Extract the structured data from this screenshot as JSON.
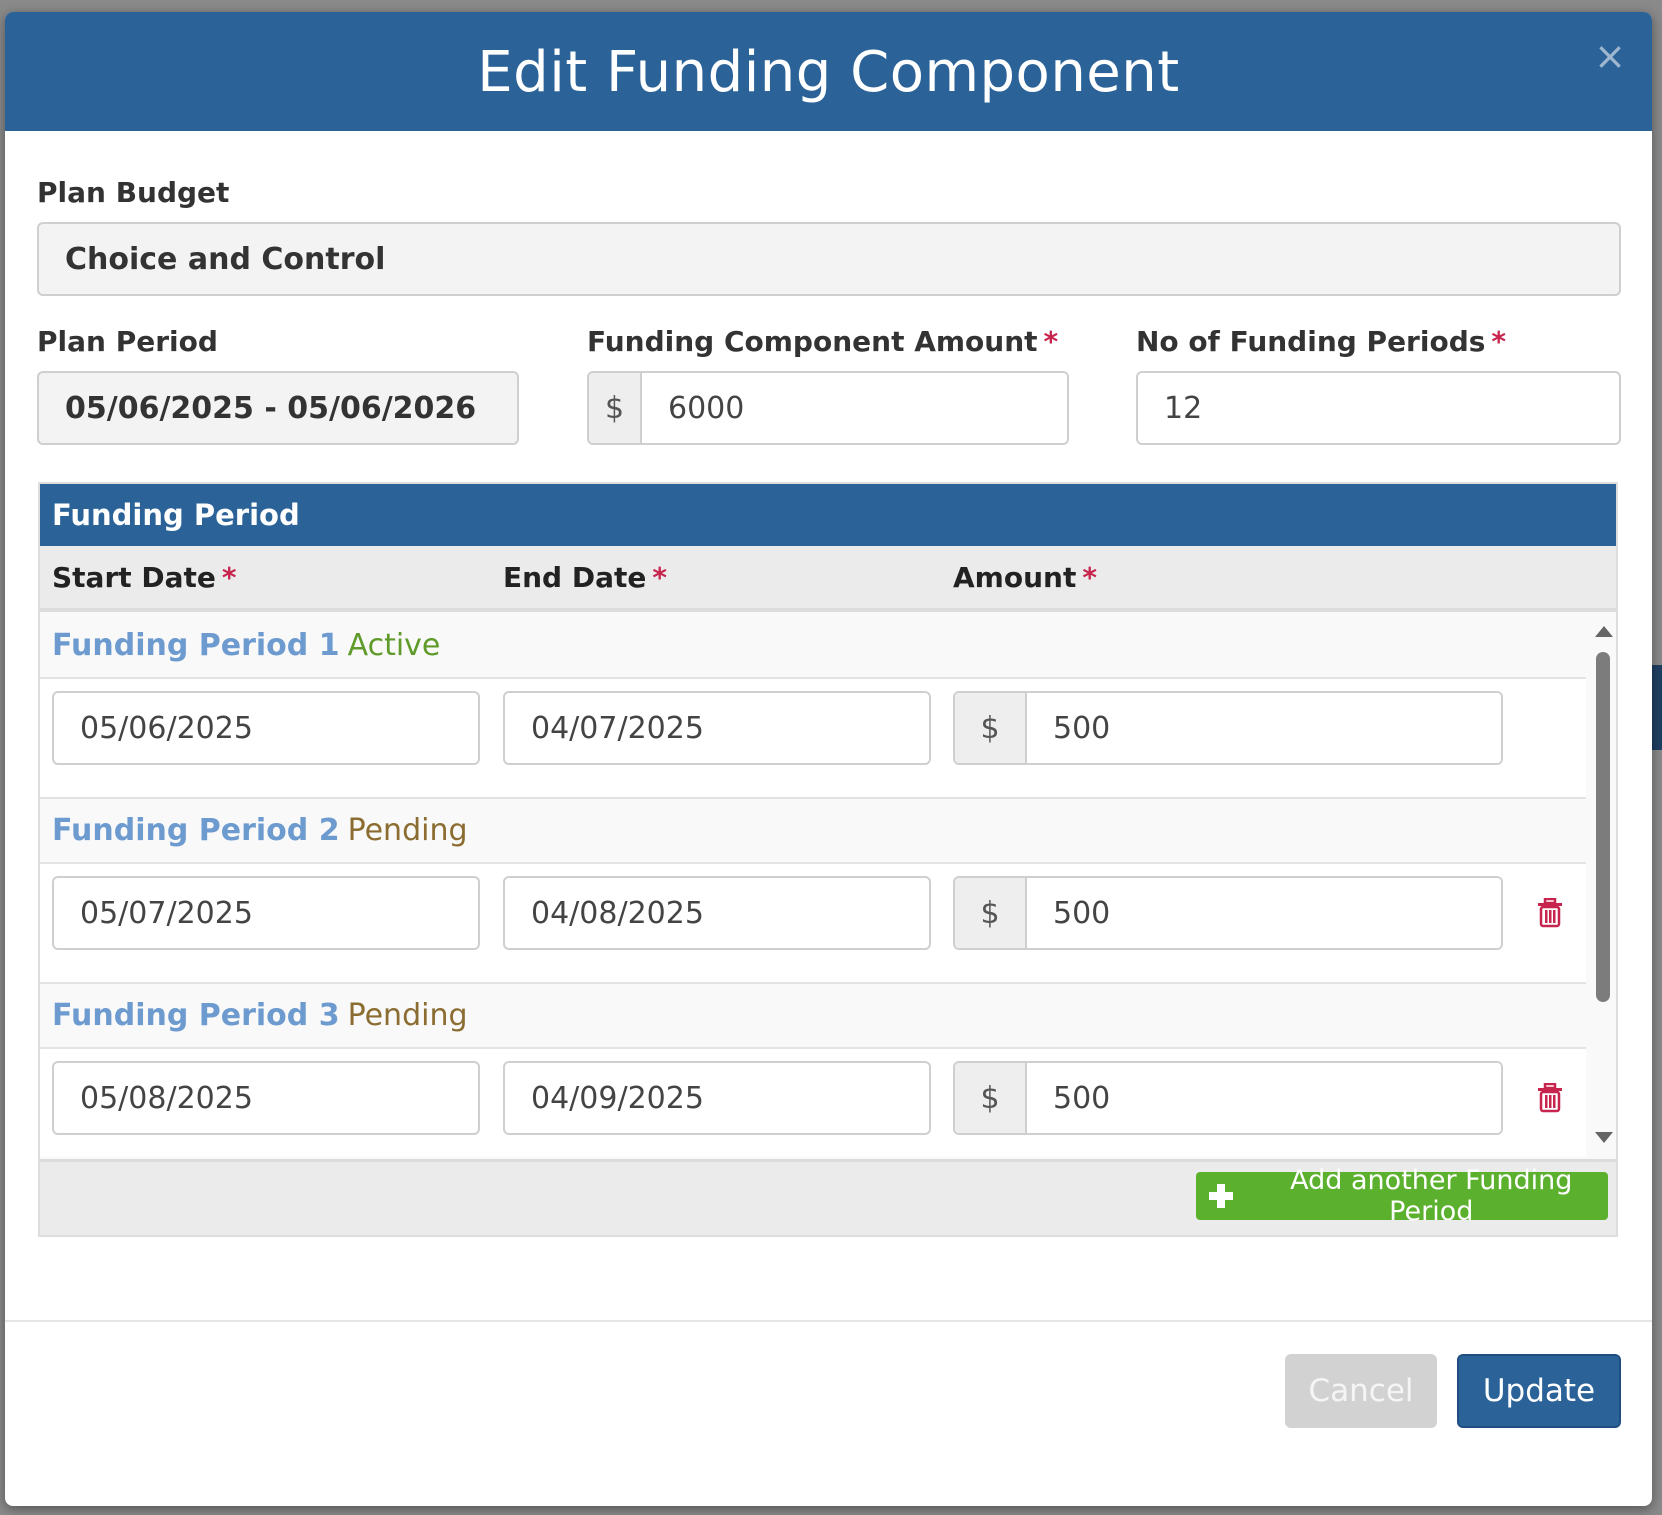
{
  "modal": {
    "title": "Edit Funding Component",
    "close_symbol": "×"
  },
  "plan_budget": {
    "label": "Plan Budget",
    "value": "Choice and Control"
  },
  "plan_period": {
    "label": "Plan Period",
    "value": "05/06/2025 - 05/06/2026"
  },
  "component_amount": {
    "label": "Funding Component Amount",
    "currency": "$",
    "value": "6000"
  },
  "num_periods": {
    "label": "No of Funding Periods",
    "value": "12"
  },
  "required_mark": "*",
  "funding_panel": {
    "title": "Funding Period",
    "columns": {
      "start": "Start Date",
      "end": "End Date",
      "amount": "Amount"
    },
    "periods": [
      {
        "title": "Funding Period 1",
        "status": "Active",
        "start": "05/06/2025",
        "end": "04/07/2025",
        "currency": "$",
        "amount": "500"
      },
      {
        "title": "Funding Period 2",
        "status": "Pending",
        "start": "05/07/2025",
        "end": "04/08/2025",
        "currency": "$",
        "amount": "500"
      },
      {
        "title": "Funding Period 3",
        "status": "Pending",
        "start": "05/08/2025",
        "end": "04/09/2025",
        "currency": "$",
        "amount": "500"
      }
    ],
    "add_label": "Add another Funding Period"
  },
  "footer": {
    "cancel_label": "Cancel",
    "update_label": "Update"
  },
  "colors": {
    "primary": "#2b6399",
    "success": "#5bb12d",
    "required": "#c7254e",
    "active_status": "#5f9a2a",
    "pending_status": "#8b6d32"
  },
  "icons": [
    "close-icon",
    "plus-icon",
    "trash-icon"
  ]
}
